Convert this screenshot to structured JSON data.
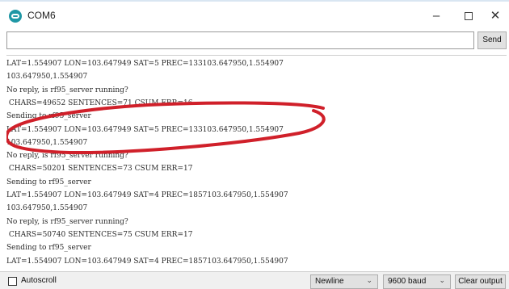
{
  "window": {
    "title": "COM6",
    "icon": "arduino-serial-icon",
    "minimize_glyph": "–",
    "close_glyph": "✕"
  },
  "send_bar": {
    "input_value": "",
    "send_label": "Send"
  },
  "output": {
    "lines": [
      "LAT=1.554907 LON=103.647949 SAT=5 PREC=133103.647950,1.554907",
      "103.647950,1.554907",
      "No reply, is rf95_server running?",
      " CHARS=49652 SENTENCES=71 CSUM ERR=16",
      "Sending to rf95_server",
      "LAT=1.554907 LON=103.647949 SAT=5 PREC=133103.647950,1.554907",
      "103.647950,1.554907",
      "No reply, is rf95_server running?",
      " CHARS=50201 SENTENCES=73 CSUM ERR=17",
      "Sending to rf95_server",
      "LAT=1.554907 LON=103.647949 SAT=4 PREC=1857103.647950,1.554907",
      "103.647950,1.554907",
      "No reply, is rf95_server running?",
      " CHARS=50740 SENTENCES=75 CSUM ERR=17",
      "Sending to rf95_server",
      "LAT=1.554907 LON=103.647949 SAT=4 PREC=1857103.647950,1.554907"
    ],
    "annotation_color": "#d0202a"
  },
  "footer": {
    "autoscroll_label": "Autoscroll",
    "autoscroll_checked": false,
    "line_ending": "Newline",
    "baud_rate": "9600 baud",
    "clear_label": "Clear output",
    "dropdown_glyph": "⌄"
  }
}
